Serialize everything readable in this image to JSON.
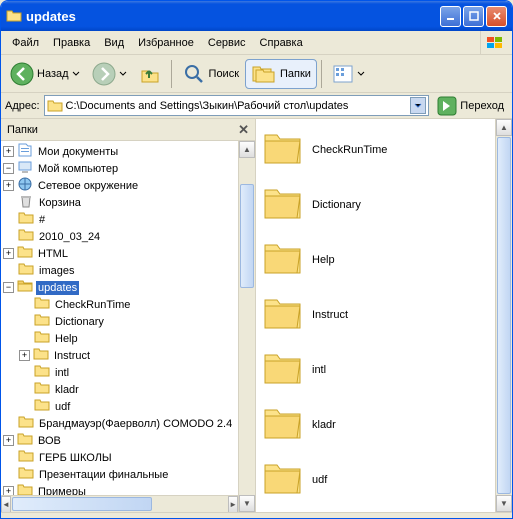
{
  "window": {
    "title": "updates"
  },
  "menu": {
    "file": "Файл",
    "edit": "Правка",
    "view": "Вид",
    "favorites": "Избранное",
    "tools": "Сервис",
    "help": "Справка"
  },
  "toolbar": {
    "back": "Назад",
    "search": "Поиск",
    "folders": "Папки"
  },
  "address": {
    "label": "Адрес:",
    "value": "C:\\Documents and Settings\\Зыкин\\Рабочий стол\\updates",
    "go": "Переход"
  },
  "side": {
    "title": "Папки"
  },
  "tree": [
    {
      "d": 0,
      "e": "+",
      "i": "doc",
      "t": "Мои документы"
    },
    {
      "d": 0,
      "e": "-",
      "i": "pc",
      "t": "Мой компьютер"
    },
    {
      "d": 0,
      "e": "+",
      "i": "net",
      "t": "Сетевое окружение"
    },
    {
      "d": 0,
      "e": "",
      "i": "bin",
      "t": "Корзина"
    },
    {
      "d": 0,
      "e": "",
      "i": "f",
      "t": "#"
    },
    {
      "d": 0,
      "e": "",
      "i": "f",
      "t": "2010_03_24"
    },
    {
      "d": 0,
      "e": "+",
      "i": "f",
      "t": "HTML"
    },
    {
      "d": 0,
      "e": "",
      "i": "f",
      "t": "images"
    },
    {
      "d": 0,
      "e": "-",
      "i": "fo",
      "t": "updates",
      "sel": true
    },
    {
      "d": 1,
      "e": "",
      "i": "f",
      "t": "CheckRunTime"
    },
    {
      "d": 1,
      "e": "",
      "i": "f",
      "t": "Dictionary"
    },
    {
      "d": 1,
      "e": "",
      "i": "f",
      "t": "Help"
    },
    {
      "d": 1,
      "e": "+",
      "i": "f",
      "t": "Instruct"
    },
    {
      "d": 1,
      "e": "",
      "i": "f",
      "t": "intl"
    },
    {
      "d": 1,
      "e": "",
      "i": "f",
      "t": "kladr"
    },
    {
      "d": 1,
      "e": "",
      "i": "f",
      "t": "udf"
    },
    {
      "d": 0,
      "e": "",
      "i": "f",
      "t": "Брандмауэр(Фаерволл) COMODO 2.4"
    },
    {
      "d": 0,
      "e": "+",
      "i": "f",
      "t": "ВОВ"
    },
    {
      "d": 0,
      "e": "",
      "i": "f",
      "t": "ГЕРБ  ШКОЛЫ"
    },
    {
      "d": 0,
      "e": "",
      "i": "f",
      "t": "Презентации финальные"
    },
    {
      "d": 0,
      "e": "+",
      "i": "f",
      "t": "Примеры"
    }
  ],
  "folders": [
    "CheckRunTime",
    "Dictionary",
    "Help",
    "Instruct",
    "intl",
    "kladr",
    "udf"
  ]
}
